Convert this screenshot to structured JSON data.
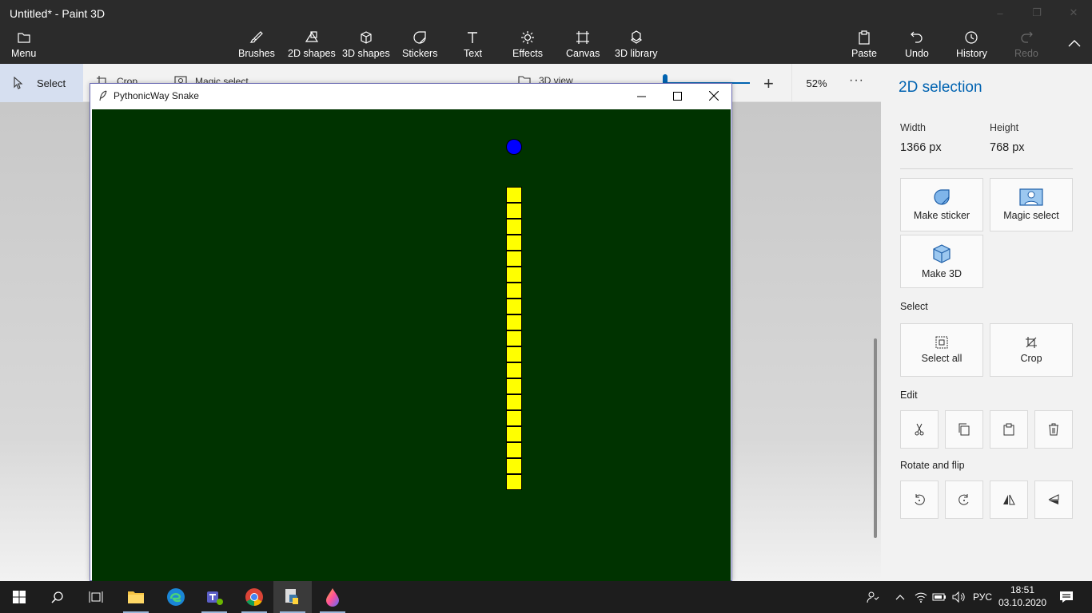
{
  "window": {
    "title": "Untitled* - Paint 3D"
  },
  "ribbon": {
    "menu": "Menu",
    "tools": [
      "Brushes",
      "2D shapes",
      "3D shapes",
      "Stickers",
      "Text",
      "Effects",
      "Canvas",
      "3D library"
    ],
    "paste": "Paste",
    "undo": "Undo",
    "history": "History",
    "redo": "Redo"
  },
  "subtoolbar": {
    "select": "Select",
    "crop": "Crop",
    "magic_select": "Magic select",
    "view_3d": "3D view",
    "zoom": "52%",
    "more": "···"
  },
  "snake_window": {
    "title": "PythonicWay Snake",
    "colors": {
      "background": "#003300",
      "snake": "#ffff00",
      "food": "#0000ff"
    },
    "food_cells": {
      "col": 26,
      "row": 2
    },
    "snake_length": 19
  },
  "panel": {
    "title": "2D selection",
    "width_label": "Width",
    "width_value": "1366 px",
    "height_label": "Height",
    "height_value": "768 px",
    "make_sticker": "Make sticker",
    "magic_select": "Magic select",
    "make_3d": "Make 3D",
    "select_section": "Select",
    "select_all": "Select all",
    "crop": "Crop",
    "edit_section": "Edit",
    "rotate_section": "Rotate and flip"
  },
  "taskbar": {
    "language": "РУС",
    "time": "18:51",
    "date": "03.10.2020"
  }
}
